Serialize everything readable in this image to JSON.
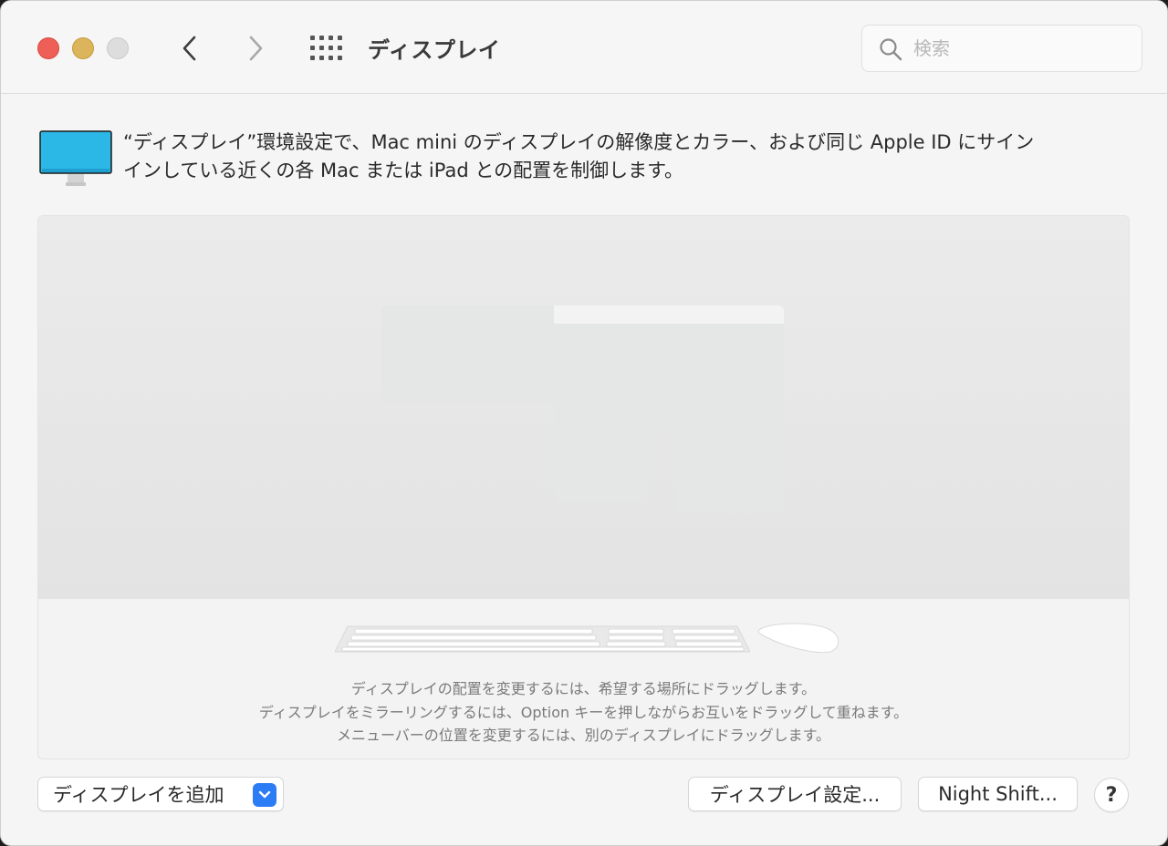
{
  "window": {
    "title": "ディスプレイ"
  },
  "search": {
    "placeholder": "検索"
  },
  "header": {
    "description_line1": "“ディスプレイ”環境設定で、Mac mini のディスプレイの解像度とカラー、および同じ Apple ID にサイン",
    "description_line2": "インしている近くの各 Mac または iPad との配置を制御します。"
  },
  "arrangement": {
    "hint1": "ディスプレイの配置を変更するには、希望する場所にドラッグします。",
    "hint2": "ディスプレイをミラーリングするには、Option キーを押しながらお互いをドラッグして重ねます。",
    "hint3": "メニューバーの位置を変更するには、別のディスプレイにドラッグします。"
  },
  "buttons": {
    "add_display": "ディスプレイを追加",
    "display_settings": "ディスプレイ設定...",
    "night_shift": "Night Shift...",
    "help": "?"
  },
  "colors": {
    "close": "#ee5f57",
    "minimize": "#dbb45c",
    "accent": "#2c7cf6",
    "monitor_screen": "#2bb8e6"
  }
}
